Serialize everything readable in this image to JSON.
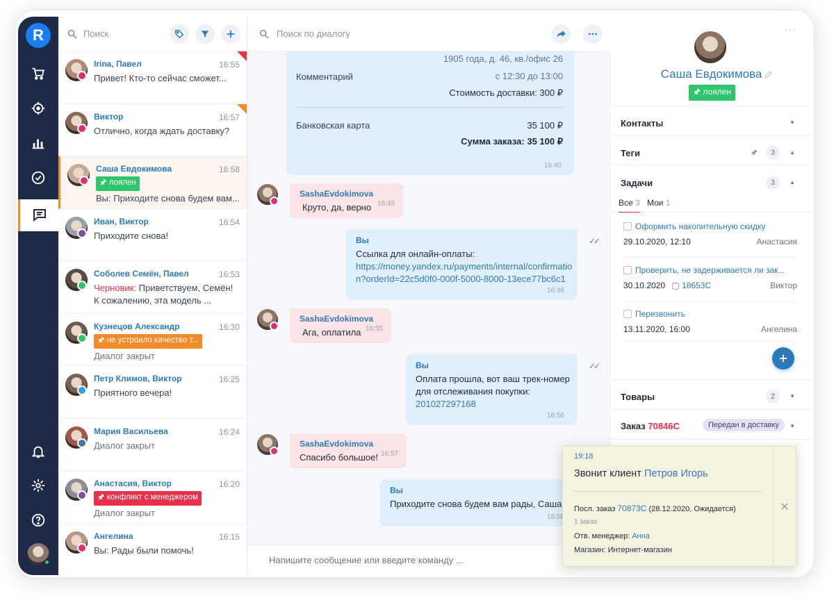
{
  "rail": {
    "logo_glyph": "R",
    "icons": [
      "cart-icon",
      "target-icon",
      "chart-icon",
      "check-circle-icon",
      "chat-icon",
      "bell-icon",
      "gear-icon",
      "help-icon"
    ]
  },
  "conv_list": {
    "search_placeholder": "Поиск",
    "items": [
      {
        "name": "Irina, Павел",
        "time": "16:55",
        "text": "Привет! Кто-то сейчас сможет...",
        "channel": "instagram",
        "flag": "#e8304a",
        "avatar": "#b58a78"
      },
      {
        "name": "Виктор",
        "time": "16:57",
        "text": "Отлично, когда ждать доставку?",
        "channel": "instagram",
        "flag": "#f38b2a",
        "avatar": "#8a6a55"
      },
      {
        "name": "Саша Евдокимова",
        "time": "16:58",
        "tag": "🖈 лоялен",
        "tag_color": "#2fc56a",
        "text": "Вы: Приходите снова будем вам...",
        "channel": "instagram",
        "avatar": "#c8a896"
      },
      {
        "name": "Иван, Виктор",
        "time": "16:54",
        "text": "Приходите снова!",
        "channel": "viber",
        "avatar": "#9aa0aa"
      },
      {
        "name": "Соболев Семён, Павел",
        "time": "16:53",
        "draft": "Черновик:",
        "text": " Приветствуем, Семён!",
        "text2": "К сожалению, эта модель ...",
        "channel": "whatsapp",
        "avatar": "#5a4a42"
      },
      {
        "name": "Кузнецов Александр",
        "time": "16:30",
        "tag": "🖈 не устроило качество т...",
        "tag_color": "#f38b2a",
        "text": "Диалог закрыт",
        "channel": "whatsapp",
        "avatar": "#6a5a50"
      },
      {
        "name": "Петр Климов, Виктор",
        "time": "16:25",
        "text": "Приятного вечера!",
        "channel": "telegram",
        "avatar": "#7a6252"
      },
      {
        "name": "Мария Васильева",
        "time": "16:24",
        "text": "Диалог закрыт",
        "channel": "vk",
        "avatar": "#a4584a"
      },
      {
        "name": "Анастасия, Виктор",
        "time": "16:20",
        "tag": "🖈 конфликт с менеджером",
        "tag_color": "#e8304a",
        "text": "Диалог закрыт",
        "channel": "viber",
        "avatar": "#8c8c94"
      },
      {
        "name": "Ангелина",
        "time": "16:15",
        "text": "Вы: Рады были помочь!",
        "channel": "instagram",
        "avatar": "#b99888"
      }
    ]
  },
  "chat": {
    "search_placeholder": "Поиск по диалогу",
    "order": {
      "address_tail": "1905 года, д. 46, кв./офис 26",
      "comment_label": "Комментарий",
      "comment_value": "с 12:30 до 13:00",
      "delivery": "Стоимость доставки: 300 ₽",
      "pay_label": "Банковская карта",
      "pay_value": "35 100 ₽",
      "total": "Сумма заказа: 35 100 ₽",
      "time": "16:40"
    },
    "messages": [
      {
        "who": "SashaEvdokimova",
        "text": "Круто, да, верно",
        "time": "16:45"
      },
      {
        "who": "Вы",
        "text": "Ссылка для онлайн-оплаты:",
        "link1": "https://money.yandex.ru/payments/internal/confirmatio",
        "link2": "n?orderId=22c5d0f0-000f-5000-8000-13ece77bc6c1",
        "time": "16:46"
      },
      {
        "who": "SashaEvdokimova",
        "text": "Ага, оплатила",
        "time": "16:55"
      },
      {
        "who": "Вы",
        "text": "Оплата прошла, вот ваш трек-номер",
        "text2": "для отслеживания покупки:",
        "link1": "201027297168",
        "time": "16:56"
      },
      {
        "who": "SashaEvdokimova",
        "text": "Спасибо большое!",
        "time": "16:57"
      },
      {
        "who": "Вы",
        "text": "Приходите снова будем вам рады, Саша!",
        "time": "16:58"
      }
    ],
    "input_placeholder": "Напишите сообщение или введите команду ..."
  },
  "profile": {
    "name": "Саша Евдокимова",
    "tag": "🖈 лоялен",
    "sections": {
      "contacts": "Контакты",
      "tags": "Теги",
      "tags_count": "3",
      "tasks": "Задачи",
      "tasks_count": "3",
      "goods": "Товары",
      "goods_count": "2",
      "order_label": "Заказ",
      "order_num": "70846С",
      "order_status": "Передан в доставку"
    },
    "task_tabs": {
      "all": "Все",
      "all_count": "3",
      "mine": "Мои",
      "mine_count": "1"
    },
    "tasks": [
      {
        "title": "Оформить накопительную скидку",
        "date": "29.10.2020, 12:10",
        "person": "Анастасия"
      },
      {
        "title": "Проверить, не задерживается ли зак...",
        "date": "30.10.2020",
        "ref": "18653С",
        "person": "Виктор"
      },
      {
        "title": "Перезвонить",
        "date": "13.11.2020, 16:00",
        "person": "Ангелина"
      }
    ]
  },
  "call_popup": {
    "time": "19:18",
    "title": "Звонит клиент",
    "client": "Петров Игорь",
    "last_order_label": "Посл. заказ",
    "last_order": "70873С",
    "last_order_info": "(28.12.2020, Ожидается)",
    "orders": "1 заказ",
    "manager_label": "Отв. менеджер:",
    "manager": "Анна",
    "shop_label": "Магазин:",
    "shop": "Интернет-магазин"
  },
  "colors": {
    "rail": "#1d2a48",
    "accent": "#f38b2a",
    "link": "#2e7ab8",
    "primary": "#1a7ef0"
  }
}
